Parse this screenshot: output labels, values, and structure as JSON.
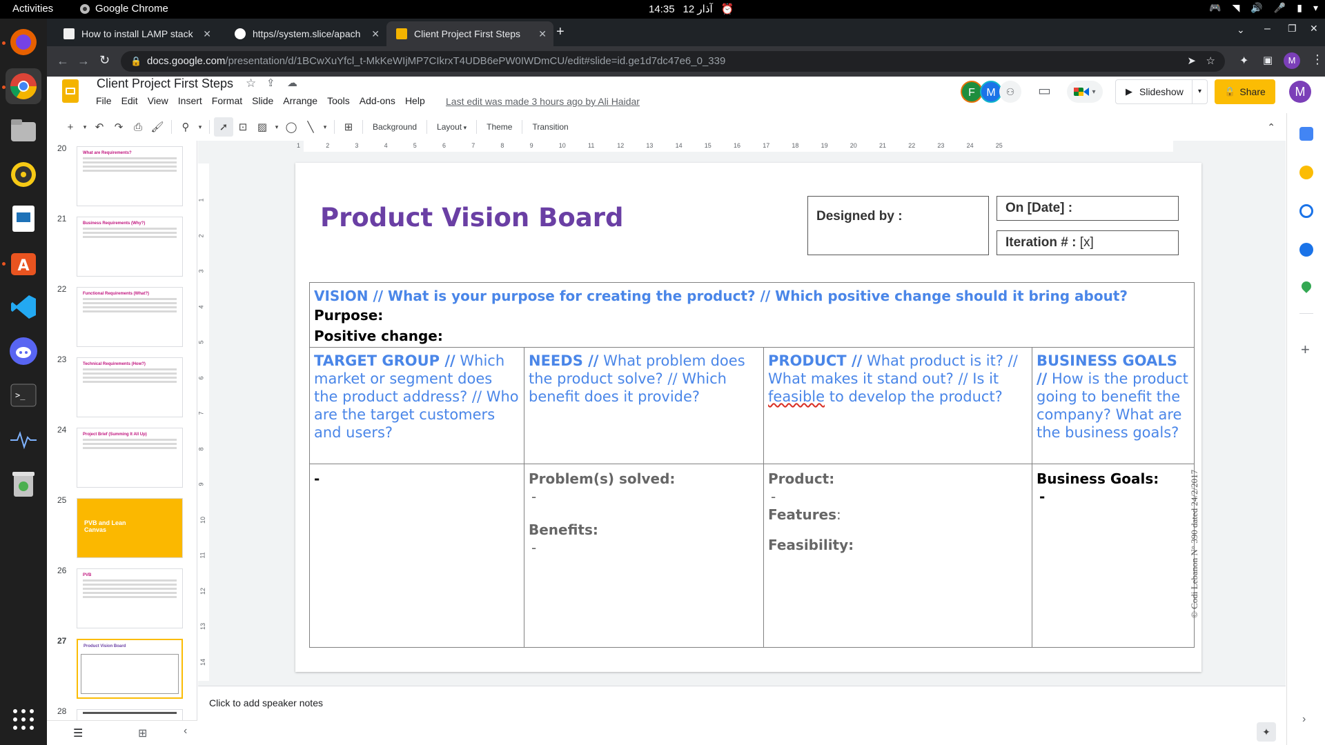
{
  "system_bar": {
    "activities": "Activities",
    "app_name": "Google Chrome",
    "time": "14:35",
    "date": "12 آذار"
  },
  "dock": {
    "items": [
      "Firefox",
      "Chrome",
      "Files",
      "Rhythmbox",
      "LibreOffice Impress",
      "Ubuntu Software",
      "VS Code",
      "Discord",
      "Terminal",
      "System Monitor",
      "Trash",
      "Show Applications"
    ]
  },
  "chrome": {
    "tabs": [
      {
        "title": "How to install LAMP stack"
      },
      {
        "title": "https//system.slice/apach"
      },
      {
        "title": "Client Project First Steps"
      }
    ],
    "url_host": "docs.google.com",
    "url_path": "/presentation/d/1BCwXuYfcl_t-MkKeWIjMP7CIkrxT4UDB6ePW0IWDmCU/edit#slide=id.ge1d7dc47e6_0_339",
    "profile_initial": "M"
  },
  "docs": {
    "title": "Client Project First Steps",
    "menu": [
      "File",
      "Edit",
      "View",
      "Insert",
      "Format",
      "Slide",
      "Arrange",
      "Tools",
      "Add-ons",
      "Help"
    ],
    "last_edit": "Last edit was made 3 hours ago by Ali Haidar",
    "avatars": [
      {
        "initial": "F",
        "color": "#1e8e3e"
      },
      {
        "initial": "M",
        "color": "#1a73e8"
      }
    ],
    "slideshow_label": "Slideshow",
    "share_label": "Share",
    "user_initial": "M"
  },
  "edit_toolbar": {
    "background": "Background",
    "layout": "Layout",
    "theme": "Theme",
    "transition": "Transition"
  },
  "ruler": {
    "horizontal": [
      "1",
      "2",
      "3",
      "4",
      "5",
      "6",
      "7",
      "8",
      "9",
      "10",
      "11",
      "12",
      "13",
      "14",
      "15",
      "16",
      "17",
      "18",
      "19",
      "20",
      "21",
      "22",
      "23",
      "24",
      "25"
    ],
    "vertical": [
      "1",
      "2",
      "3",
      "4",
      "5",
      "6",
      "7",
      "8",
      "9",
      "10",
      "11",
      "12",
      "13",
      "14"
    ]
  },
  "filmstrip": {
    "slides": [
      {
        "num": "20",
        "title": "What are Requirements?"
      },
      {
        "num": "21",
        "title": "Business Requirements (Why?)"
      },
      {
        "num": "22",
        "title": "Functional Requirements (What?)"
      },
      {
        "num": "23",
        "title": "Technical Requirements (How?)"
      },
      {
        "num": "24",
        "title": "Project Brief (Summing It All Up)"
      },
      {
        "num": "25",
        "title": "PVB and Lean Canvas"
      },
      {
        "num": "26",
        "title": "PVB"
      },
      {
        "num": "27",
        "title": "Product Vision Board"
      },
      {
        "num": "28",
        "title": ""
      }
    ]
  },
  "slide": {
    "title": "Product Vision Board",
    "designed_by": "Designed by :",
    "on_date": "On [Date] :",
    "iteration_label": "Iteration # :",
    "iteration_value": "[x]",
    "vision_heading": "VISION // What is your purpose for creating the product? // Which positive change should it bring about?",
    "purpose": "Purpose:",
    "positive_change": "Positive change:",
    "target_group_head": "TARGET GROUP //",
    "target_group_text": "Which market or segment does the product address? // Who are the target customers and users?",
    "needs_head": "NEEDS //",
    "needs_text": "What problem does the product solve? // Which benefit does it provide?",
    "product_head": "PRODUCT //",
    "product_text_a": "What product is it? // What makes it stand out? // Is it ",
    "product_text_b": "feasible",
    "product_text_c": " to develop the product?",
    "business_head": "BUSINESS GOALS //",
    "business_text": "How is the product going to benefit the company? What are the business goals?",
    "target_body": "-",
    "problems_label": "Problem(s) solved:",
    "problems_value": "-",
    "benefits_label": "Benefits:",
    "benefits_value": "-",
    "product_label": "Product:",
    "product_value": "-",
    "features_label": "Features",
    "features_colon": ":",
    "feasibility_label": "Feasibility:",
    "business_goals_label": "Business Goals:",
    "business_goals_value": "-",
    "copyright": "© Codi Lebanon N° 390 dated 24/2/2017"
  },
  "notes": {
    "placeholder": "Click to add speaker notes"
  }
}
